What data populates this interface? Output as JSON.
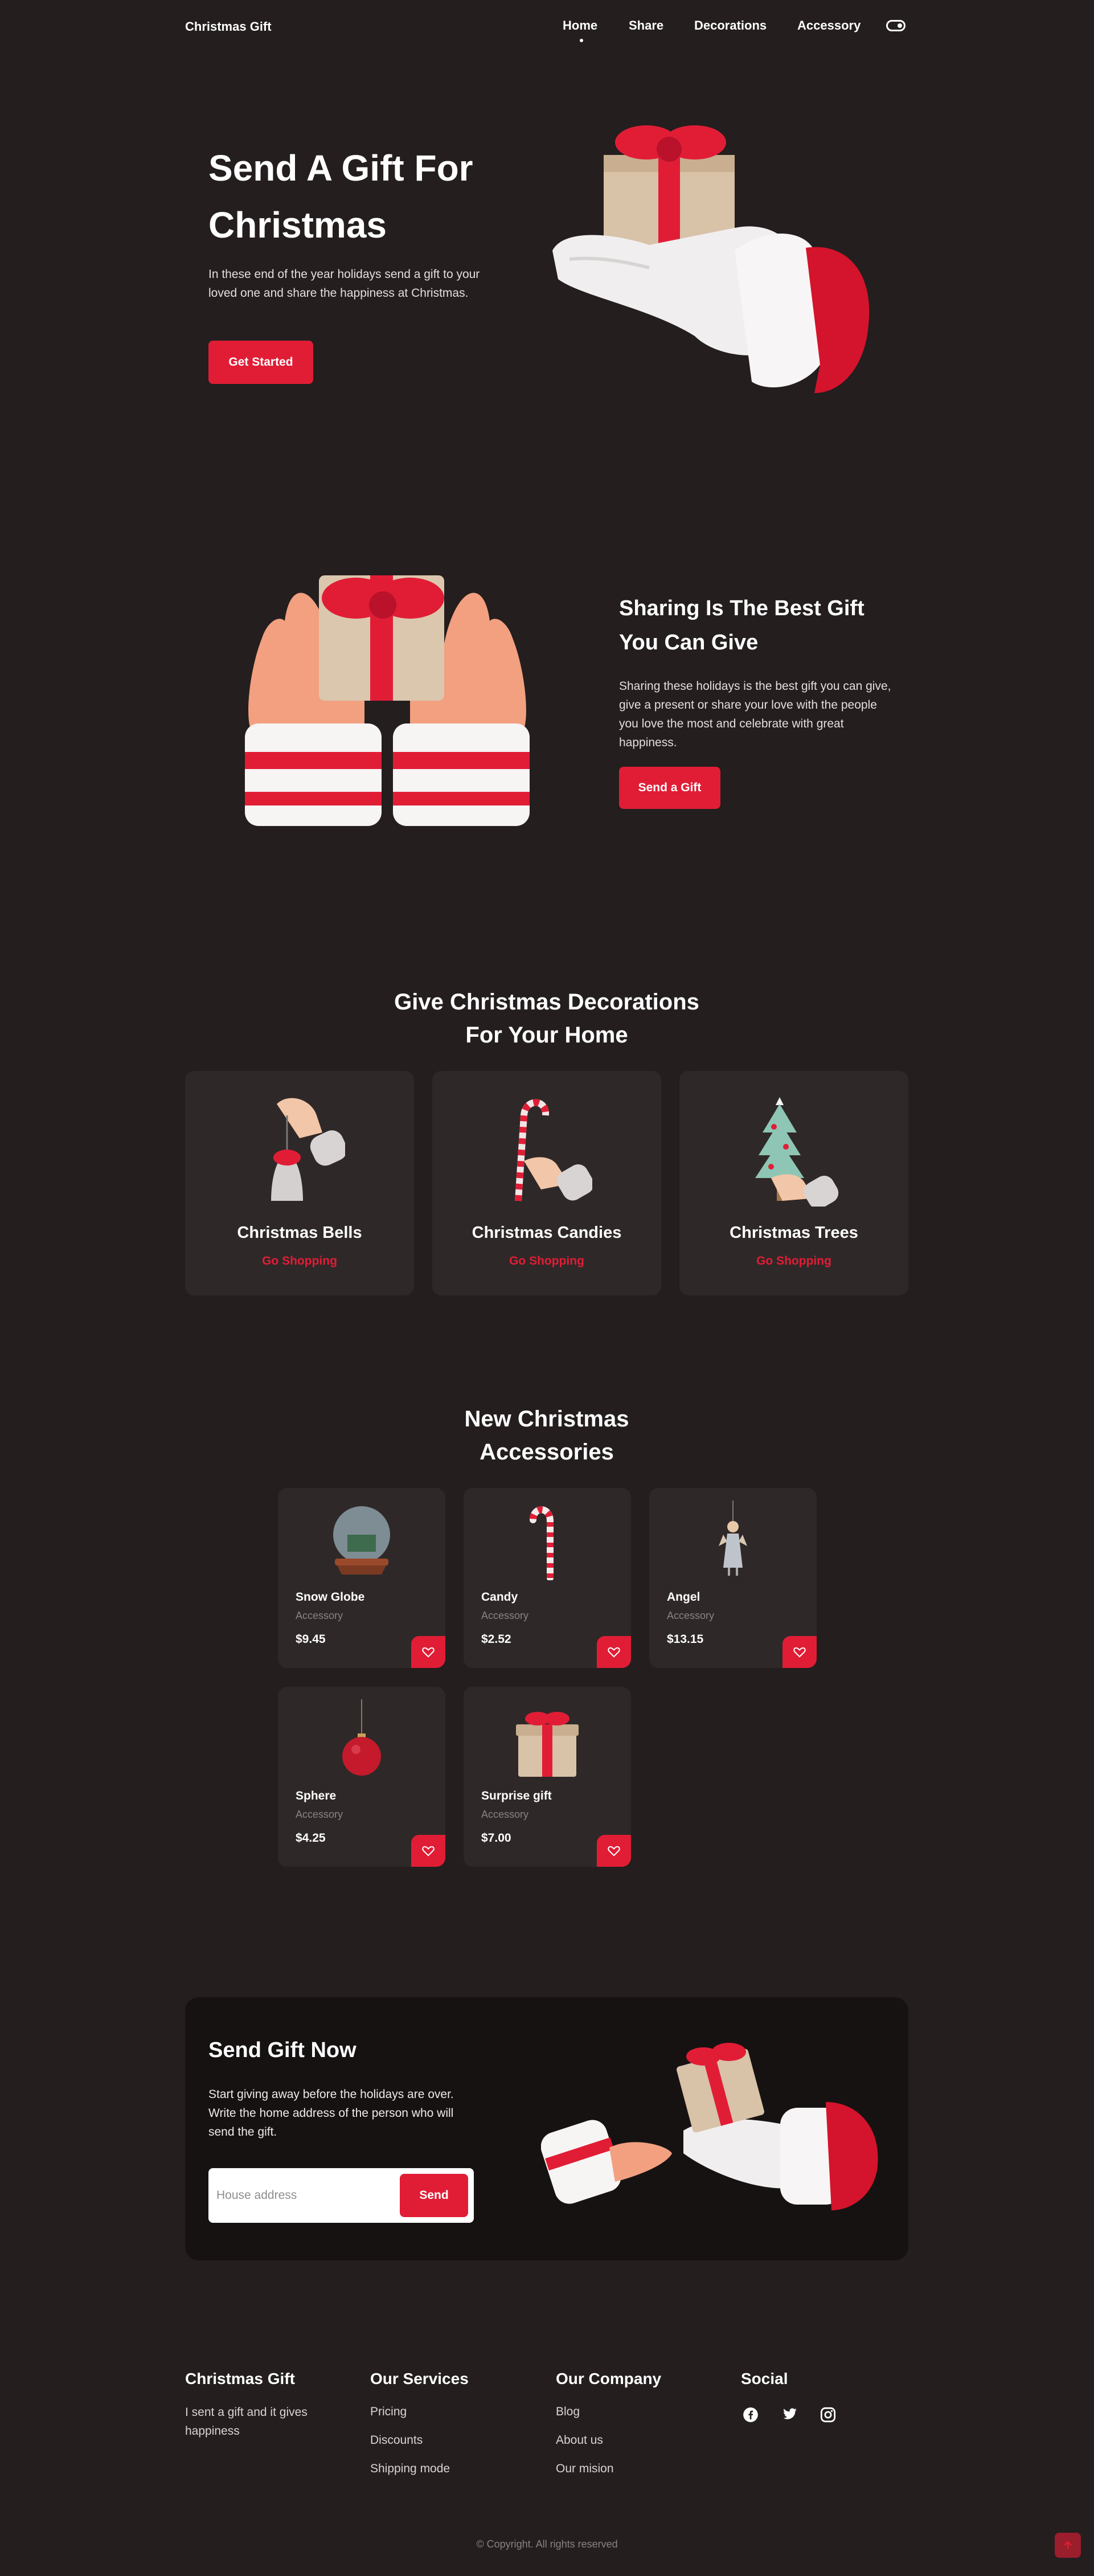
{
  "header": {
    "logo": "Christmas Gift",
    "nav": [
      {
        "label": "Home"
      },
      {
        "label": "Share"
      },
      {
        "label": "Decorations"
      },
      {
        "label": "Accessory"
      }
    ]
  },
  "hero": {
    "title": "Send A Gift For Christmas",
    "text": "In these end of the year holidays send a gift to your loved one and share the happiness at Christmas.",
    "button": "Get Started"
  },
  "share": {
    "title": "Sharing Is The Best Gift You Can Give",
    "text": "Sharing these holidays is the best gift you can give, give a present or share your love with the people you love the most and celebrate with great happiness.",
    "button": "Send a Gift"
  },
  "decorations": {
    "title_line1": "Give Christmas Decorations",
    "title_line2": "For Your Home",
    "cards": [
      {
        "title": "Christmas Bells",
        "link": "Go Shopping"
      },
      {
        "title": "Christmas Candies",
        "link": "Go Shopping"
      },
      {
        "title": "Christmas Trees",
        "link": "Go Shopping"
      }
    ]
  },
  "accessories": {
    "title_line1": "New Christmas",
    "title_line2": "Accessories",
    "items": [
      {
        "name": "Snow Globe",
        "category": "Accessory",
        "price": "$9.45"
      },
      {
        "name": "Candy",
        "category": "Accessory",
        "price": "$2.52"
      },
      {
        "name": "Angel",
        "category": "Accessory",
        "price": "$13.15"
      },
      {
        "name": "Sphere",
        "category": "Accessory",
        "price": "$4.25"
      },
      {
        "name": "Surprise gift",
        "category": "Accessory",
        "price": "$7.00"
      }
    ]
  },
  "send": {
    "title": "Send Gift Now",
    "text": "Start giving away before the holidays are over. Write the home address of the person who will send the gift.",
    "placeholder": "House address",
    "button": "Send"
  },
  "footer": {
    "brand_title": "Christmas Gift",
    "brand_text": "I sent a gift and it gives happiness",
    "services_title": "Our Services",
    "services": [
      "Pricing",
      "Discounts",
      "Shipping mode"
    ],
    "company_title": "Our Company",
    "company": [
      "Blog",
      "About us",
      "Our mision"
    ],
    "social_title": "Social",
    "copyright": "© Copyright. All rights reserved"
  },
  "colors": {
    "background": "#241e1e",
    "card": "#2f2828",
    "accent": "#e11d36",
    "send_box": "#171212"
  }
}
